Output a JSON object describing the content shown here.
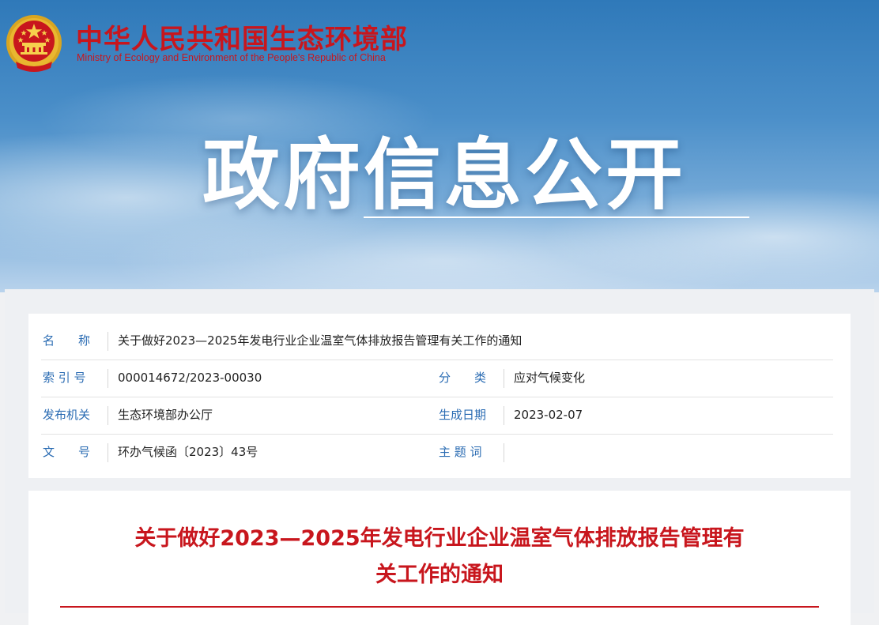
{
  "header": {
    "site_name_cn": "中华人民共和国生态环境部",
    "site_name_en": "Ministry of Ecology and Environment of the People's Republic of China",
    "banner_title": "政府信息公开"
  },
  "meta": {
    "name_label": "名　　称",
    "name_value": "关于做好2023—2025年发电行业企业温室气体排放报告管理有关工作的通知",
    "index_label": "索 引 号",
    "index_value": "000014672/2023-00030",
    "category_label": "分　　类",
    "category_value": "应对气候变化",
    "issuer_label": "发布机关",
    "issuer_value": "生态环境部办公厅",
    "date_label": "生成日期",
    "date_value": "2023-02-07",
    "doc_no_label": "文　　号",
    "doc_no_value": "环办气候函〔2023〕43号",
    "keywords_label": "主 题 词",
    "keywords_value": ""
  },
  "article": {
    "title_line1": "关于做好2023—2025年发电行业企业温室气体排放报告管理有",
    "title_line2": "关工作的通知"
  },
  "colors": {
    "brand_red": "#c8161d",
    "label_blue": "#2b6cb3"
  },
  "icons": {
    "logo": "national-emblem-icon"
  }
}
